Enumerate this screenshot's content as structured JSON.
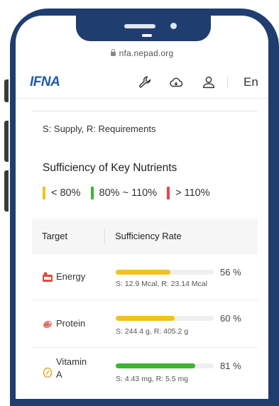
{
  "browser": {
    "url": "nfa.nepad.org"
  },
  "header": {
    "logo_text": "IFNA",
    "language_label": "En",
    "icons": [
      "wrench-icon",
      "cloud-icon",
      "user-icon"
    ]
  },
  "legend_abbrev": "S: Supply, R: Requirements",
  "section_title": "Sufficiency of Key Nutrients",
  "legend": [
    {
      "label": "< 80%",
      "color": "#f2c21b"
    },
    {
      "label": "80% ~ 110%",
      "color": "#3cb532"
    },
    {
      "label": "> 110%",
      "color": "#ef4444"
    }
  ],
  "table": {
    "col_target": "Target",
    "col_rate": "Sufficiency Rate",
    "rows": [
      {
        "icon": "energy-icon",
        "label": "Energy",
        "percent_label": "56 %",
        "fill": 0.56,
        "color": "#f2c21b",
        "detail": "S: 12.9 Mcal, R: 23.14 Mcal"
      },
      {
        "icon": "protein-icon",
        "label": "Protein",
        "percent_label": "60 %",
        "fill": 0.6,
        "color": "#f2c21b",
        "detail": "S: 244.4 g, R: 405.2 g"
      },
      {
        "icon": "vitamin-icon",
        "label_line1": "Vitamin",
        "label_line2": "A",
        "percent_label": "81 %",
        "fill": 0.81,
        "color": "#3cb532",
        "detail": "S: 4.43 mg, R: 5.5 mg"
      }
    ]
  }
}
